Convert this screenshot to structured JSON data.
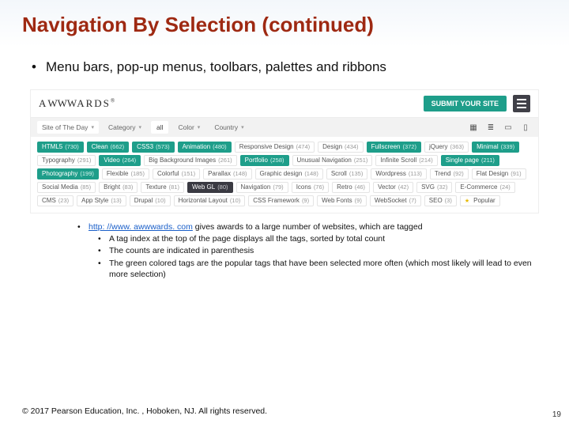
{
  "slide": {
    "title": "Navigation By Selection (continued)",
    "bullet1": "Menu bars, pop-up menus, toolbars, palettes and ribbons",
    "link_text": "http: //www. awwwards. com",
    "link_tail": " gives awards to a large number of websites, which are tagged",
    "sub_a": "A tag index at the top of the page displays all the tags, sorted by total count",
    "sub_b": "The counts are indicated in parenthesis",
    "sub_c": "The green colored tags are the popular tags that have been selected more often (which most likely will lead to even more selection)",
    "footer": "© 2017 Pearson Education, Inc. , Hoboken, NJ.  All rights reserved.",
    "page": "19"
  },
  "shot": {
    "logo_a": "A",
    "logo_w": "WWW",
    "logo_tail": "ARDS",
    "submit": "SUBMIT YOUR SITE",
    "filters": {
      "site": "Site of The Day",
      "category": "Category",
      "all": "all",
      "color": "Color",
      "country": "Country"
    },
    "tags": [
      {
        "n": "HTML5",
        "c": "730",
        "cls": "pop"
      },
      {
        "n": "Clean",
        "c": "662",
        "cls": "pop"
      },
      {
        "n": "CSS3",
        "c": "573",
        "cls": "pop"
      },
      {
        "n": "Animation",
        "c": "480",
        "cls": "pop"
      },
      {
        "n": "Responsive Design",
        "c": "474",
        "cls": ""
      },
      {
        "n": "Design",
        "c": "434",
        "cls": ""
      },
      {
        "n": "Fullscreen",
        "c": "372",
        "cls": "pop"
      },
      {
        "n": "jQuery",
        "c": "363",
        "cls": ""
      },
      {
        "n": "Minimal",
        "c": "339",
        "cls": "pop"
      },
      {
        "n": "Typography",
        "c": "291",
        "cls": ""
      },
      {
        "n": "Video",
        "c": "264",
        "cls": "pop"
      },
      {
        "n": "Big Background Images",
        "c": "261",
        "cls": ""
      },
      {
        "n": "Portfolio",
        "c": "258",
        "cls": "pop"
      },
      {
        "n": "Unusual Navigation",
        "c": "251",
        "cls": ""
      },
      {
        "n": "Infinite Scroll",
        "c": "214",
        "cls": ""
      },
      {
        "n": "Single page",
        "c": "211",
        "cls": "pop"
      },
      {
        "n": "Photography",
        "c": "199",
        "cls": "pop"
      },
      {
        "n": "Flexible",
        "c": "185",
        "cls": ""
      },
      {
        "n": "Colorful",
        "c": "151",
        "cls": ""
      },
      {
        "n": "Parallax",
        "c": "148",
        "cls": ""
      },
      {
        "n": "Graphic design",
        "c": "148",
        "cls": ""
      },
      {
        "n": "Scroll",
        "c": "135",
        "cls": ""
      },
      {
        "n": "Wordpress",
        "c": "113",
        "cls": ""
      },
      {
        "n": "Trend",
        "c": "92",
        "cls": ""
      },
      {
        "n": "Flat Design",
        "c": "91",
        "cls": ""
      },
      {
        "n": "Social Media",
        "c": "85",
        "cls": ""
      },
      {
        "n": "Bright",
        "c": "83",
        "cls": ""
      },
      {
        "n": "Texture",
        "c": "81",
        "cls": ""
      },
      {
        "n": "Web GL",
        "c": "80",
        "cls": "dark"
      },
      {
        "n": "Navigation",
        "c": "79",
        "cls": ""
      },
      {
        "n": "Icons",
        "c": "76",
        "cls": ""
      },
      {
        "n": "Retro",
        "c": "46",
        "cls": ""
      },
      {
        "n": "Vector",
        "c": "42",
        "cls": ""
      },
      {
        "n": "SVG",
        "c": "32",
        "cls": ""
      },
      {
        "n": "E-Commerce",
        "c": "24",
        "cls": ""
      },
      {
        "n": "CMS",
        "c": "23",
        "cls": ""
      },
      {
        "n": "App Style",
        "c": "13",
        "cls": ""
      },
      {
        "n": "Drupal",
        "c": "10",
        "cls": ""
      },
      {
        "n": "Horizontal Layout",
        "c": "10",
        "cls": ""
      },
      {
        "n": "CSS Framework",
        "c": "9",
        "cls": ""
      },
      {
        "n": "Web Fonts",
        "c": "9",
        "cls": ""
      },
      {
        "n": "WebSocket",
        "c": "7",
        "cls": ""
      },
      {
        "n": "SEO",
        "c": "3",
        "cls": ""
      },
      {
        "n": "Popular",
        "c": "",
        "cls": "star"
      }
    ]
  }
}
